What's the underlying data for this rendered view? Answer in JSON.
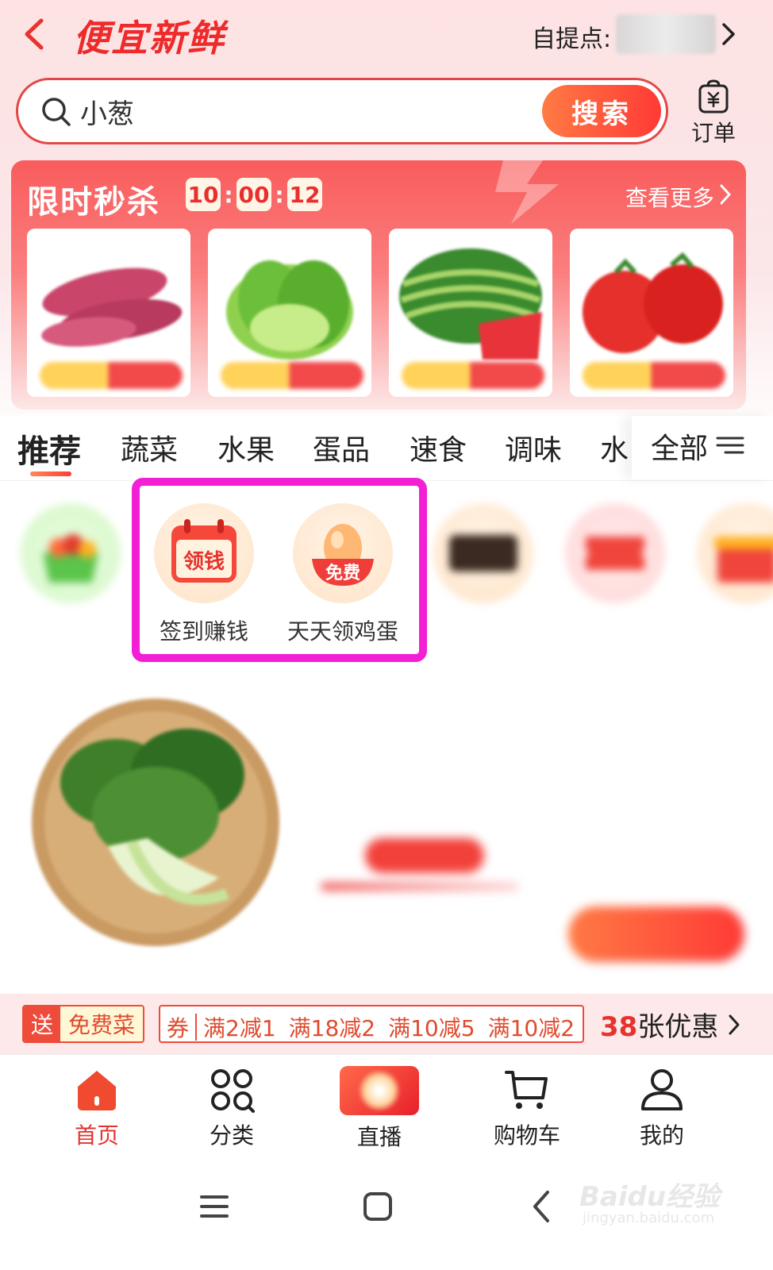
{
  "header": {
    "title": "便宜新鲜",
    "pickup_label": "自提点:",
    "pickup_value": ""
  },
  "search": {
    "value": "小葱",
    "button_label": "搜索",
    "order_label": "订单"
  },
  "flash_sale": {
    "title": "限时秒杀",
    "timer": [
      "10",
      "00",
      "12"
    ],
    "more_label": "查看更多",
    "items": [
      {
        "icon": "sweet-potato"
      },
      {
        "icon": "lettuce"
      },
      {
        "icon": "watermelon"
      },
      {
        "icon": "tomato"
      }
    ]
  },
  "tabs": {
    "items": [
      "推荐",
      "蔬菜",
      "水果",
      "蛋品",
      "速食",
      "调味",
      "水"
    ],
    "active": "推荐",
    "all_label": "全部"
  },
  "quick_icons": [
    {
      "label": "",
      "icon": "fruit-basket-icon",
      "blurred": true
    },
    {
      "label": "签到赚钱",
      "icon": "calendar-coin-icon",
      "badge": "领钱",
      "blurred": false
    },
    {
      "label": "天天领鸡蛋",
      "icon": "egg-bowl-icon",
      "badge": "免费",
      "blurred": false
    },
    {
      "label": "",
      "icon": "card-icon",
      "blurred": true
    },
    {
      "label": "",
      "icon": "ticket-icon",
      "blurred": true
    },
    {
      "label": "",
      "icon": "gift-icon",
      "blurred": true
    }
  ],
  "product": {
    "title": "",
    "subtitle": "",
    "sold": "",
    "badge": "",
    "price": "",
    "original_price": "",
    "cart_label": ""
  },
  "coupon_bar": {
    "send_label": "送",
    "free_label": "免费菜",
    "coupon_head": "券",
    "coupons": [
      "满2减1",
      "满18减2",
      "满10减5",
      "满10减2"
    ],
    "count_num": "38",
    "count_text": "张优惠"
  },
  "bottom_nav": [
    {
      "label": "首页",
      "icon": "home-icon",
      "active": true
    },
    {
      "label": "分类",
      "icon": "category-icon",
      "active": false
    },
    {
      "label": "直播",
      "icon": "live-icon",
      "active": false
    },
    {
      "label": "购物车",
      "icon": "cart-icon",
      "active": false
    },
    {
      "label": "我的",
      "icon": "profile-icon",
      "active": false
    }
  ],
  "watermark": {
    "main": "Baidu经验",
    "sub": "jingyan.baidu.com"
  },
  "colors": {
    "accent": "#ee2a2a",
    "highlight": "#f21fd4",
    "flash_bg": "#f95c5c"
  }
}
